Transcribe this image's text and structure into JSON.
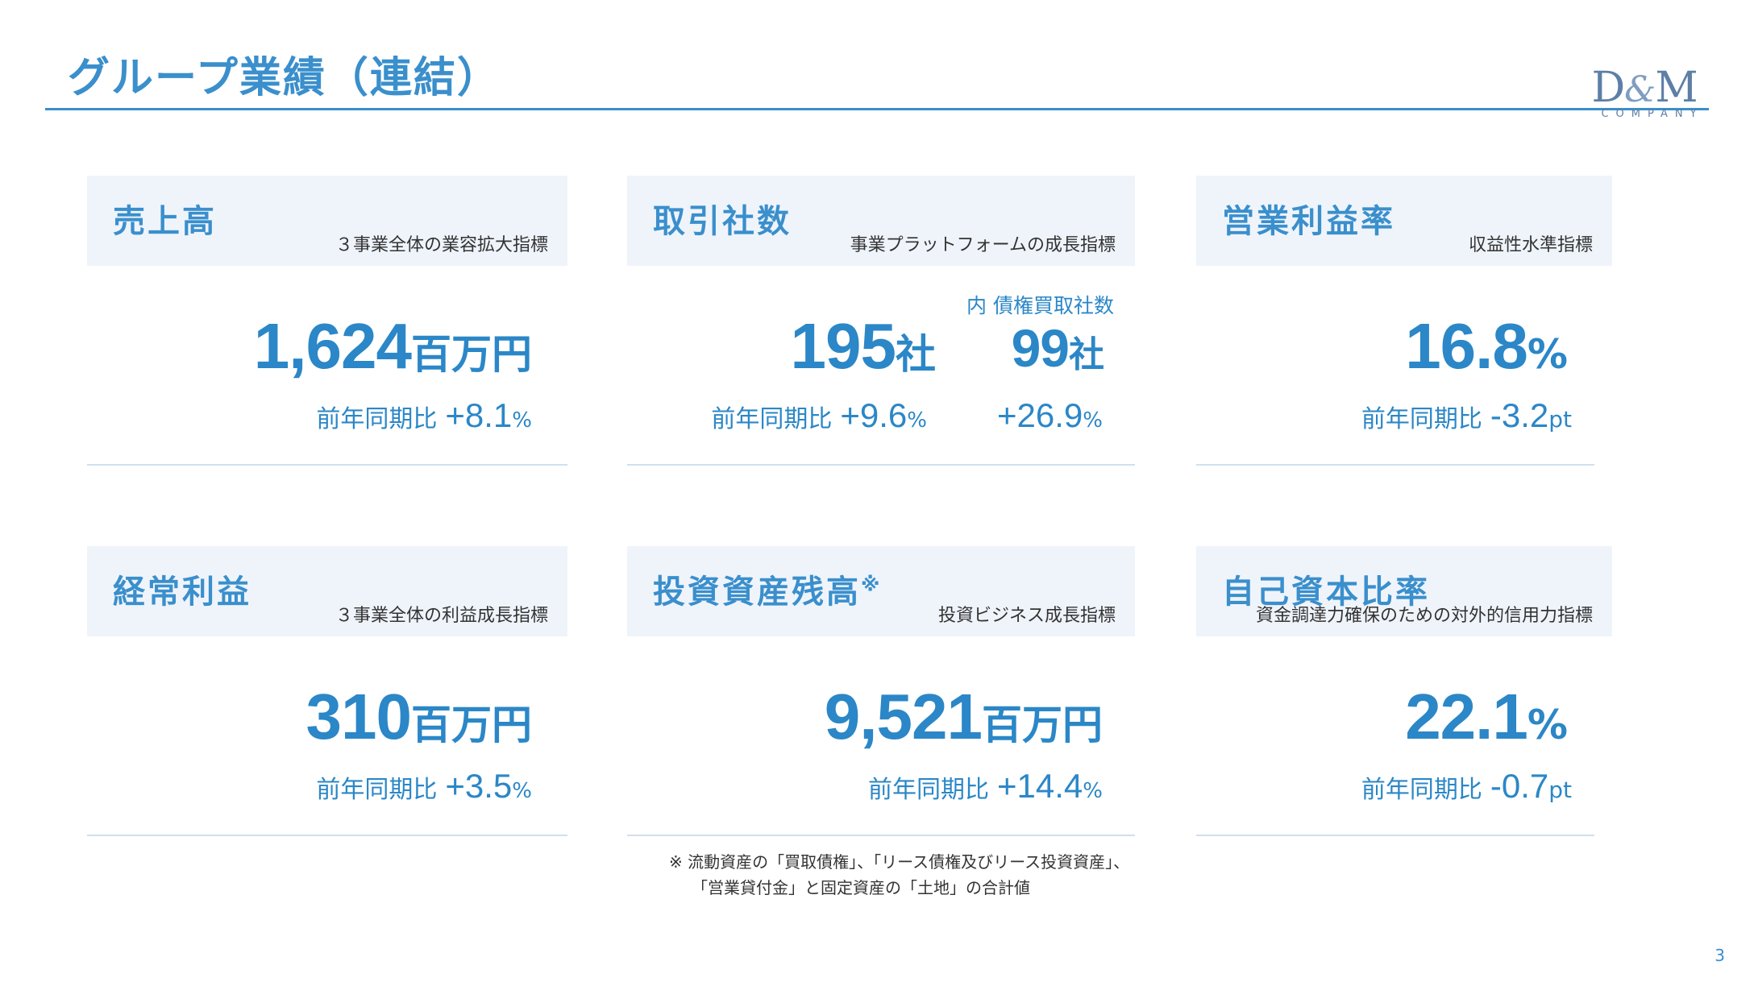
{
  "header": {
    "title": "グループ業績（連結）",
    "logo": {
      "main_1": "D",
      "amp": "&",
      "main_2": "M",
      "sub": "COMPANY"
    }
  },
  "cards": {
    "sales": {
      "title": "売上高",
      "subtitle": "３事業全体の業容拡大指標",
      "value": "1,624",
      "unit": "百万円",
      "yoy_label": "前年同期比",
      "yoy_value": "+8.1",
      "yoy_unit": "%"
    },
    "partners": {
      "title": "取引社数",
      "subtitle": "事業プラットフォームの成長指標",
      "value": "195",
      "unit": "社",
      "yoy_label": "前年同期比",
      "yoy_value": "+9.6",
      "yoy_unit": "%",
      "sub_label": "内 債権買取社数",
      "sub_value": "99",
      "sub_unit": "社",
      "sub_yoy_value": "+26.9",
      "sub_yoy_unit": "%"
    },
    "margin": {
      "title": "営業利益率",
      "subtitle": "収益性水準指標",
      "value": "16.8",
      "unit": "%",
      "yoy_label": "前年同期比",
      "yoy_value": "-3.2",
      "yoy_unit": "pt"
    },
    "ordinary_profit": {
      "title": "経常利益",
      "subtitle": "３事業全体の利益成長指標",
      "value": "310",
      "unit": "百万円",
      "yoy_label": "前年同期比",
      "yoy_value": "+3.5",
      "yoy_unit": "%"
    },
    "assets": {
      "title": "投資資産残高",
      "title_mark": "※",
      "subtitle": "投資ビジネス成長指標",
      "value": "9,521",
      "unit": "百万円",
      "yoy_label": "前年同期比",
      "yoy_value": "+14.4",
      "yoy_unit": "%"
    },
    "equity_ratio": {
      "title": "自己資本比率",
      "subtitle": "資金調達力確保のための対外的信用力指標",
      "value": "22.1",
      "unit": "%",
      "yoy_label": "前年同期比",
      "yoy_value": "-0.7",
      "yoy_unit": "pt"
    }
  },
  "footnote": {
    "line1": "※ 流動資産の「買取債権」、「リース債権及びリース投資資産」、",
    "line2": "「営業貸付金」と固定資産の「土地」の合計値"
  },
  "page_number": "3",
  "colors": {
    "accent": "#3a8fcc",
    "value": "#2b87c7",
    "header_bg": "#eff4fb",
    "logo": "#5d7fa6"
  }
}
